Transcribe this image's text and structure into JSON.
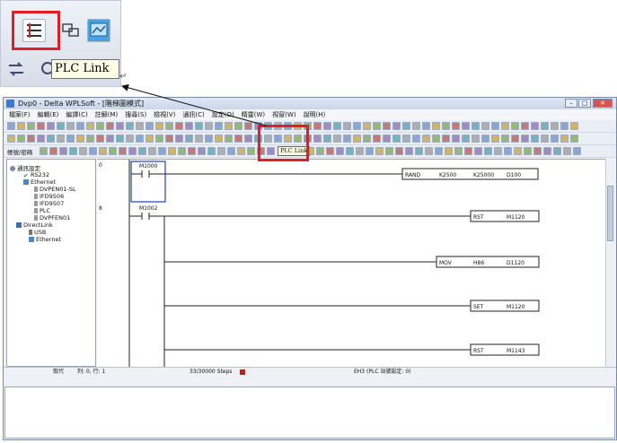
{
  "zoom": {
    "tooltip": "PLC Link",
    "return_mark": "↵"
  },
  "window": {
    "title": "Dvp0 - Delta WPLSoft - [階梯圖模式]",
    "menu": [
      "檔案(F)",
      "編輯(E)",
      "編譯(C)",
      "註解(M)",
      "搜尋(S)",
      "檢視(V)",
      "通訊(C)",
      "設定(O)",
      "精靈(W)",
      "視窗(W)",
      "說明(H)"
    ],
    "mode_label": "帳號/密碼",
    "plc_tooltip": "PLC Link"
  },
  "tree": {
    "root": "通訊設定",
    "items": [
      "RS232",
      "Ethernet",
      "DVPEN01-SL",
      "IFD9506",
      "IFD9507",
      "PLC",
      "DVPFEN01",
      "DirectLink",
      "USB",
      "Ethernet"
    ]
  },
  "ladder": {
    "step_numbers": [
      "0",
      "8"
    ],
    "contacts": [
      "M1000",
      "M1002"
    ],
    "instructions": [
      {
        "op": "RAND",
        "a": "K2500",
        "b": "K25000",
        "c": "D100"
      },
      {
        "op": "RST",
        "a": "",
        "b": "M1120",
        "c": ""
      },
      {
        "op": "MOV",
        "a": "H86",
        "b": "D1120",
        "c": ""
      },
      {
        "op": "SET",
        "a": "",
        "b": "M1120",
        "c": ""
      },
      {
        "op": "RST",
        "a": "",
        "b": "M1143",
        "c": ""
      }
    ]
  },
  "status": {
    "mode": "取代",
    "position": "列: 0, 行: 1",
    "steps": "33/30000 Steps",
    "plc_info": "EH3 (PLC 站號設定: 0)"
  }
}
